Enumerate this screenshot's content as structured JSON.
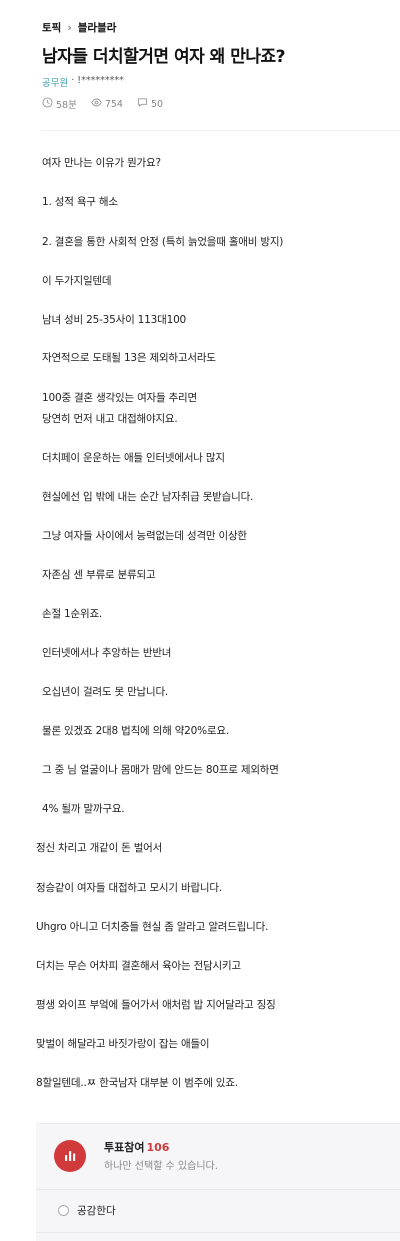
{
  "breadcrumb": {
    "topic": "토픽",
    "separator": "›",
    "board": "블라블라"
  },
  "post": {
    "title": "남자들 더치할거면 여자 왜 만나죠?",
    "author_company": "공무원",
    "author_dot": "·",
    "author_name": "!*********",
    "time": "58분",
    "views": "754",
    "comments": "50"
  },
  "body_lines": [
    "여자 만나는 이유가 뭔가요?",
    "1. 성적 욕구 해소",
    "2. 결혼을 통한 사회적 안정 (특히 늙었을때 홀애비 방지)",
    "이 두가지일텐데",
    "남녀 성비 25-35사이 113대100",
    "자연적으로 도태될 13은 제외하고서라도",
    "100중 결혼 생각있는 여자들 추리면",
    "당연히 먼저 내고 대접해야지요.",
    "더치페이 운운하는 애들 인터넷에서나 많지",
    "현실에선 입 밖에 내는 순간 남자취급 못받습니다.",
    "그냥 여자들 사이에서 능력없는데 성격만 이상한",
    "자존심 센 부류로 분류되고",
    "손절 1순위죠.",
    "인터넷에서나 추앙하는 반반녀",
    "오십년이 걸려도 못 만납니다.",
    "물론 있겠죠 2대8 법칙에 의해 약20%로요.",
    "그 중 님 얼굴이나 몸매가 맘에 안드는 80프로 제외하면",
    "4% 될까 말까구요.",
    "정신 차리고 개같이 돈 벌어서",
    "정승같이 여자들 대접하고 모시기 바랍니다.",
    "Uhgro 아니고 더치충들 현실 좀 알라고 알려드립니다.",
    "더치는 무슨 어차피 결혼해서 육아는 전담시키고",
    "평생 와이프 부엌에 들어가서 애처럼 밥 지어달라고 징징",
    "맞벌이 해달라고 바짓가랑이 잡는 애들이",
    "8할일텐데..ㅉ 한국남자 대부분 이 범주에 있죠."
  ],
  "poll": {
    "label": "투표참여",
    "count": "106",
    "subtitle": "하나만 선택할 수 있습니다.",
    "option_1": "공감한다"
  },
  "colors": {
    "accent_red": "#d13a3a",
    "company_teal": "#3aa0a8"
  },
  "icons": {
    "time": "clock-icon",
    "views": "eye-icon",
    "comments": "comment-icon",
    "poll": "bar-chart-icon"
  }
}
